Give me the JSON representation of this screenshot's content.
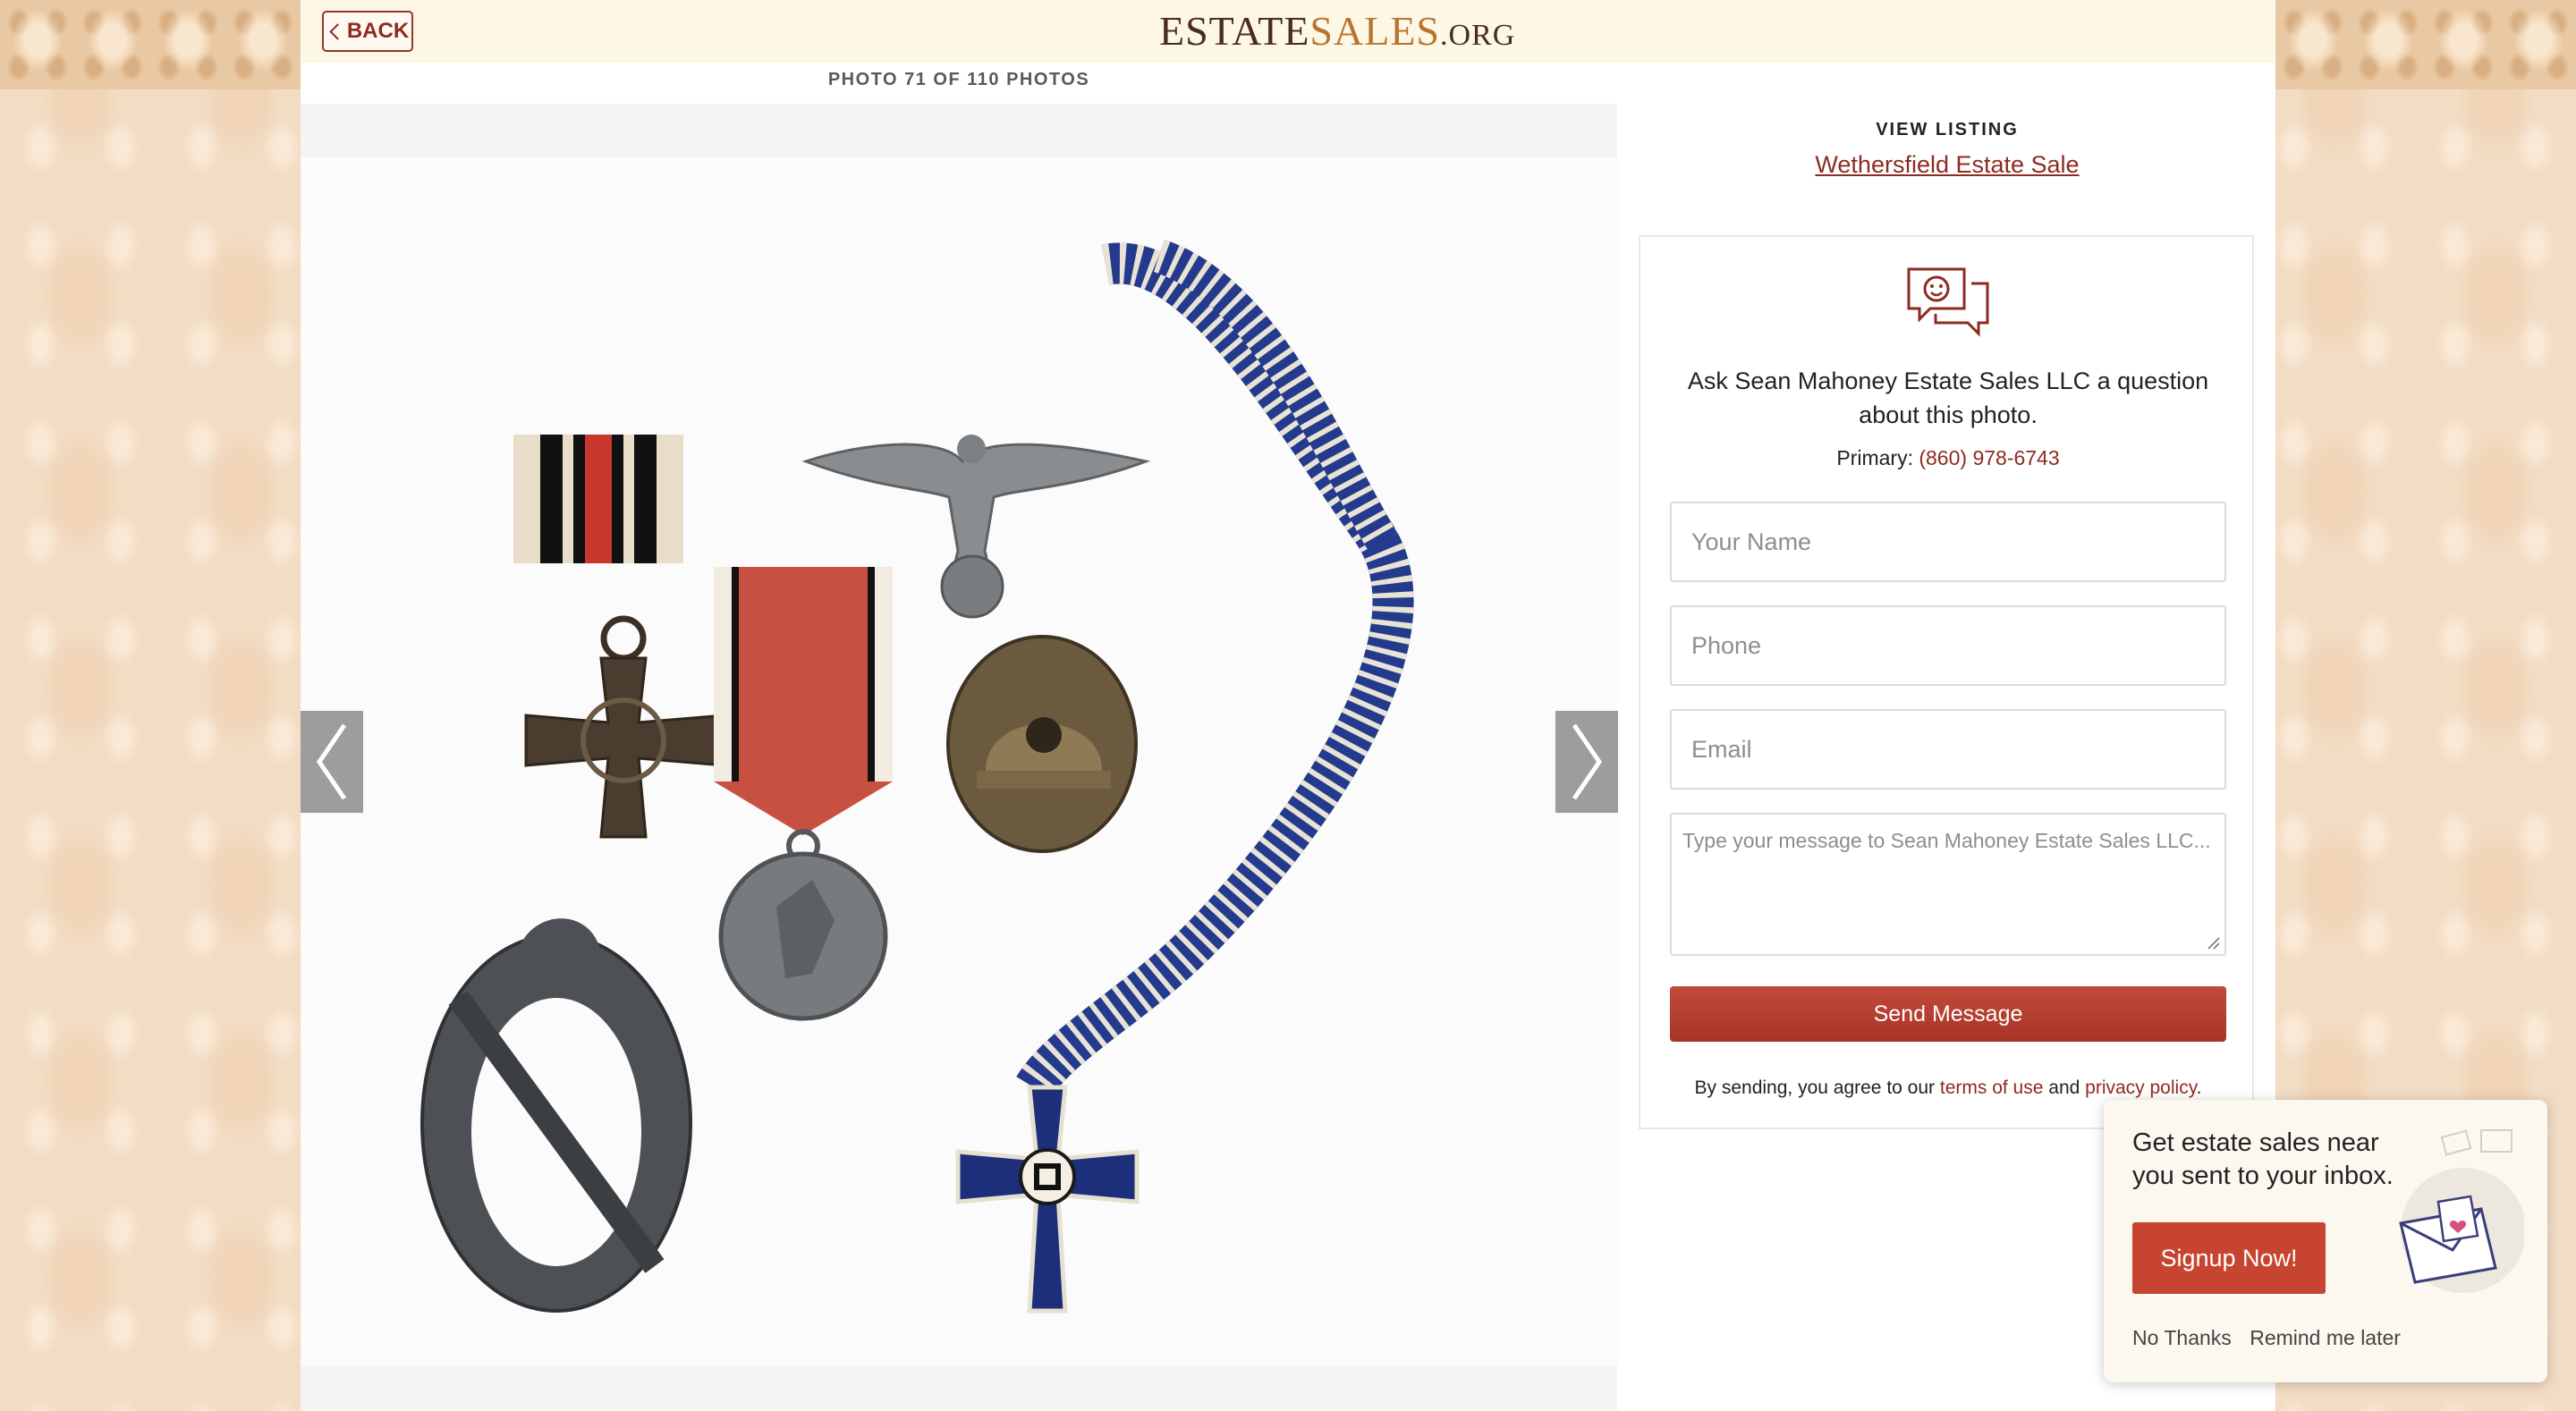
{
  "header": {
    "back_label": "BACK",
    "logo": {
      "part1": "ESTATE",
      "part2": "SALES",
      "part3": ".ORG"
    }
  },
  "gallery": {
    "counter": "PHOTO 71 OF 110 PHOTOS",
    "prev_icon": "chevron-left-icon",
    "next_icon": "chevron-right-icon"
  },
  "sidebar": {
    "view_listing_label": "VIEW LISTING",
    "listing_title": "Wethersfield Estate Sale",
    "contact": {
      "icon": "chat-bubbles-icon",
      "ask_text": "Ask Sean Mahoney Estate Sales LLC a question about this photo.",
      "primary_label": "Primary:",
      "primary_phone": "(860) 978-6743",
      "name_placeholder": "Your Name",
      "phone_placeholder": "Phone",
      "email_placeholder": "Email",
      "message_placeholder": "Type your message to Sean Mahoney Estate Sales LLC...",
      "send_label": "Send Message",
      "agree_prefix": "By sending, you agree to our",
      "terms_label": "terms of use",
      "agree_and": "and",
      "privacy_label": "privacy policy",
      "agree_suffix": "."
    }
  },
  "popup": {
    "text": "Get estate sales near you sent to your inbox.",
    "signup_label": "Signup Now!",
    "no_thanks_label": "No Thanks",
    "remind_label": "Remind me later"
  },
  "colors": {
    "brand": "#8d2b21",
    "button": "#b03a2c",
    "header_bg": "#fdf7e6",
    "signup": "#c74430"
  }
}
